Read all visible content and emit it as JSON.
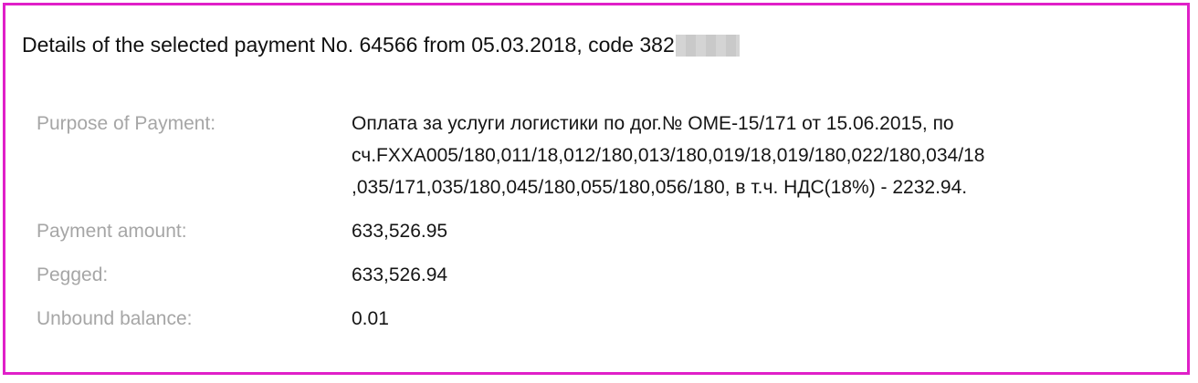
{
  "header": {
    "title": "Details of the selected payment No. 64566 from 05.03.2018, code 382"
  },
  "details": {
    "rows": [
      {
        "label": "Purpose of Payment:",
        "value": "Оплата за услуги логистики по дог.№ OME-15/171 от 15.06.2015, по\nсч.FXXA005/180,011/18,012/180,013/180,019/18,019/180,022/180,034/18\n,035/171,035/180,045/180,055/180,056/180, в т.ч. НДС(18%) - 2232.94."
      },
      {
        "label": "Payment amount:",
        "value": "633,526.95"
      },
      {
        "label": "Pegged:",
        "value": "633,526.94"
      },
      {
        "label": "Unbound balance:",
        "value": "0.01"
      }
    ]
  },
  "colors": {
    "frame_border": "#e020c8",
    "label_text": "#a6a6a6",
    "value_text": "#151515"
  }
}
